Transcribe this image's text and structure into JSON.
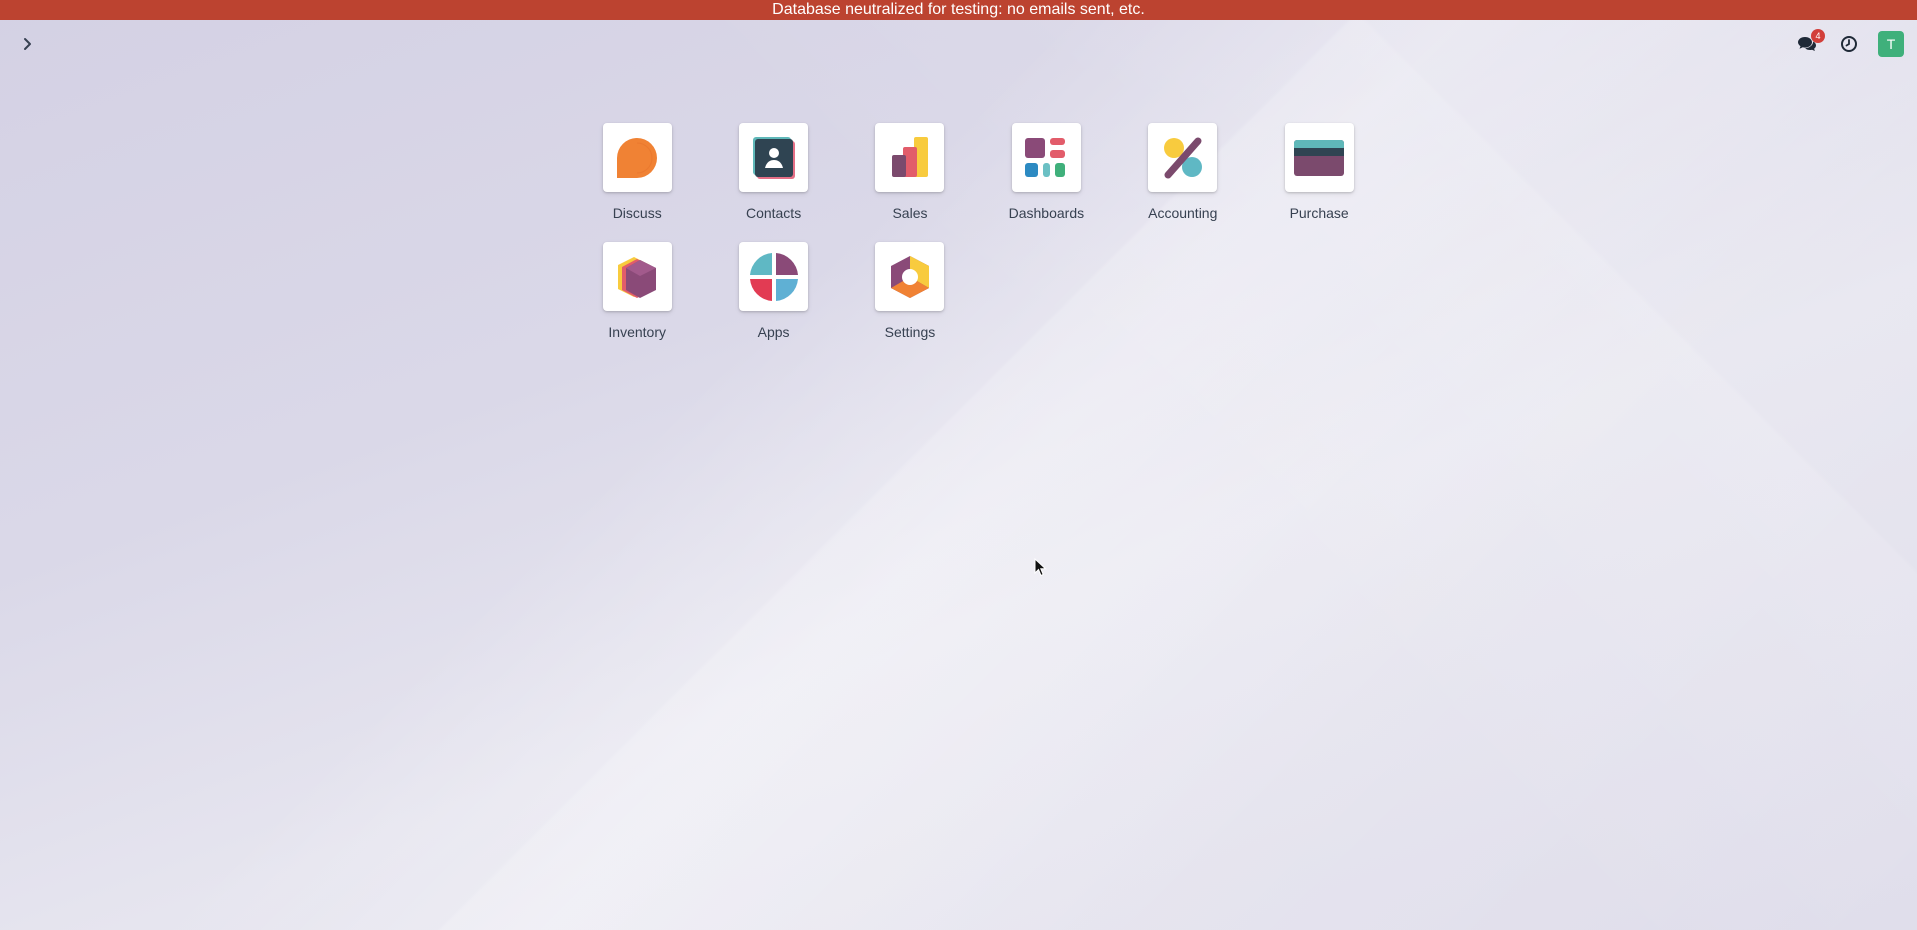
{
  "banner": {
    "text": "Database neutralized for testing: no emails sent, etc.",
    "color": "#bc4330"
  },
  "navbar": {
    "toggle_icon": "chevron-right-icon",
    "systray": {
      "messages_icon": "chat-bubbles-icon",
      "messages_count": "4",
      "activity_icon": "clock-icon",
      "avatar_initial": "T",
      "avatar_color": "#3fb07b"
    }
  },
  "apps": [
    {
      "label": "Discuss",
      "icon": "discuss-icon"
    },
    {
      "label": "Contacts",
      "icon": "contacts-icon"
    },
    {
      "label": "Sales",
      "icon": "sales-icon"
    },
    {
      "label": "Dashboards",
      "icon": "dashboards-icon"
    },
    {
      "label": "Accounting",
      "icon": "accounting-icon"
    },
    {
      "label": "Purchase",
      "icon": "purchase-icon"
    },
    {
      "label": "Inventory",
      "icon": "inventory-icon"
    },
    {
      "label": "Apps",
      "icon": "apps-icon"
    },
    {
      "label": "Settings",
      "icon": "settings-icon"
    }
  ]
}
